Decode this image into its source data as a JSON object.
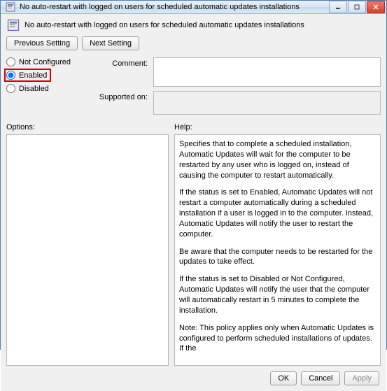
{
  "titlebar": {
    "icon": "policy-icon",
    "title": "No auto-restart with logged on users for scheduled automatic updates installations"
  },
  "header": {
    "icon": "policy-icon",
    "subtitle": "No auto-restart with logged on users for scheduled automatic updates installations"
  },
  "nav": {
    "prev_label": "Previous Setting",
    "next_label": "Next Setting"
  },
  "radios": {
    "not_configured": "Not Configured",
    "enabled": "Enabled",
    "disabled": "Disabled",
    "selected": "enabled"
  },
  "fields": {
    "comment_label": "Comment:",
    "comment_value": "",
    "supported_label": "Supported on:",
    "supported_value": ""
  },
  "panels": {
    "options_label": "Options:",
    "help_label": "Help:",
    "help_paragraphs": [
      "Specifies that to complete a scheduled installation, Automatic Updates will wait for the computer to be restarted by any user who is logged on, instead of causing the computer to restart automatically.",
      "If the status is set to Enabled, Automatic Updates will not restart a computer automatically during a scheduled installation if a user is logged in to the computer. Instead, Automatic Updates will notify the user to restart the computer.",
      "Be aware that the computer needs to be restarted for the updates to take effect.",
      "If the status is set to Disabled or Not Configured, Automatic Updates will notify the user that the computer will automatically restart in 5 minutes to complete the installation.",
      "Note: This policy applies only when Automatic Updates is configured to perform scheduled installations of updates. If the"
    ]
  },
  "footer": {
    "ok": "OK",
    "cancel": "Cancel",
    "apply": "Apply"
  }
}
